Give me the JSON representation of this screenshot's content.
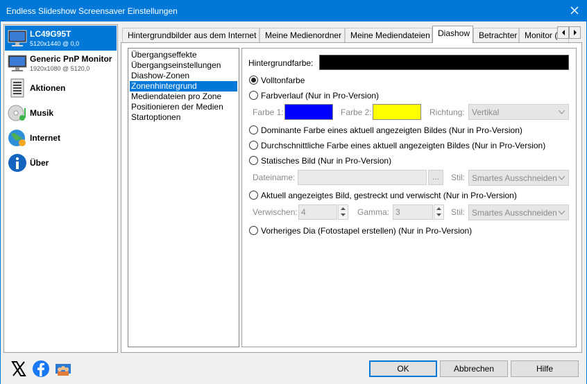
{
  "window": {
    "title": "Endless Slideshow Screensaver Einstellungen"
  },
  "sidebar": {
    "items": [
      {
        "label": "LC49G95T",
        "sub": "5120x1440 @ 0,0"
      },
      {
        "label": "Generic PnP Monitor",
        "sub": "1920x1080 @ 5120,0"
      },
      {
        "label": "Aktionen"
      },
      {
        "label": "Musik"
      },
      {
        "label": "Internet"
      },
      {
        "label": "Über"
      }
    ]
  },
  "tabs": [
    "Hintergrundbilder aus dem Internet",
    "Meine Medienordner",
    "Meine Mediendateien",
    "Diashow",
    "Betrachter",
    "Monitor ("
  ],
  "navlist": [
    "Übergangseffekte",
    "Übergangseinstellungen",
    "Diashow-Zonen",
    "Zonenhintergrund",
    "Mediendateien pro Zone",
    "Positionieren der Medien",
    "Startoptionen"
  ],
  "settings": {
    "bg_label": "Hintergrundfarbe:",
    "bg_color": "#000000",
    "options": {
      "solid": "Volltonfarbe",
      "gradient": "Farbverlauf (Nur in Pro-Version)",
      "dominant": "Dominante Farbe eines aktuell angezeigten Bildes (Nur in Pro-Version)",
      "average": "Durchschnittliche Farbe eines aktuell angezeigten Bildes (Nur in Pro-Version)",
      "static": "Statisches Bild (Nur in Pro-Version)",
      "stretched": "Aktuell angezeigtes Bild, gestreckt und verwischt (Nur in Pro-Version)",
      "previous": "Vorheriges Dia (Fotostapel erstellen) (Nur in Pro-Version)"
    },
    "gradient": {
      "color1_label": "Farbe 1:",
      "color1": "#0000ff",
      "color2_label": "Farbe 2:",
      "color2": "#ffff00",
      "direction_label": "Richtung:",
      "direction_value": "Vertikal"
    },
    "static": {
      "filename_label": "Dateiname:",
      "filename_value": "",
      "browse_label": "...",
      "style_label": "Stil:",
      "style_value": "Smartes Ausschneiden"
    },
    "stretched": {
      "blur_label": "Verwischen:",
      "blur_value": "4",
      "gamma_label": "Gamma:",
      "gamma_value": "3",
      "style_label": "Stil:",
      "style_value": "Smartes Ausschneiden"
    }
  },
  "buttons": {
    "ok": "OK",
    "cancel": "Abbrechen",
    "help": "Hilfe"
  },
  "colors": {
    "accent": "#0078d7"
  }
}
